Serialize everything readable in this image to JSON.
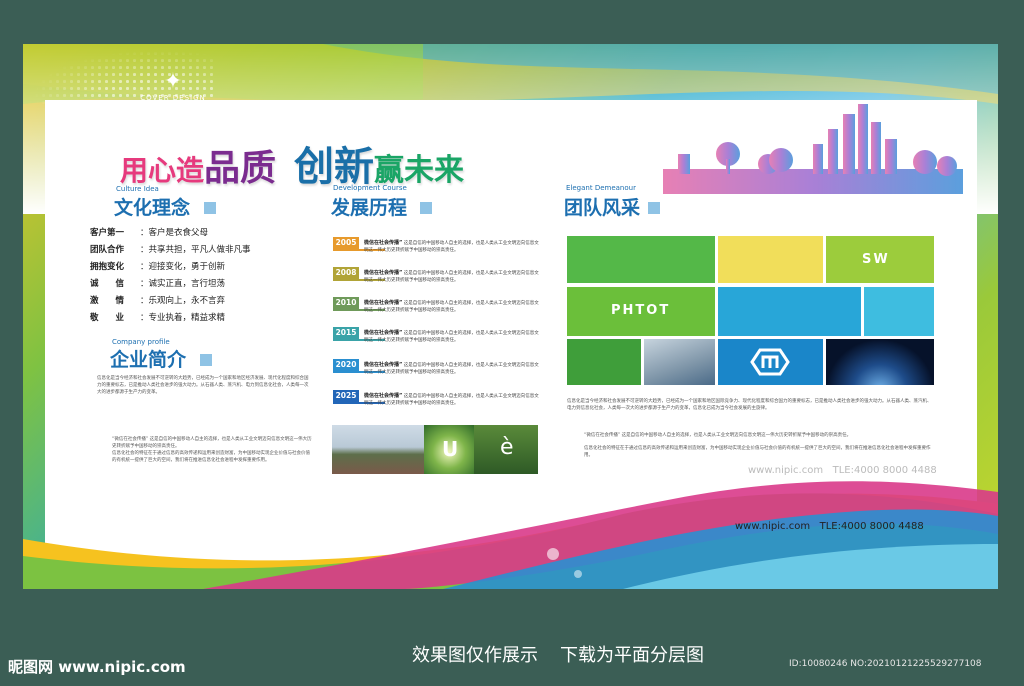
{
  "logo": {
    "mark": "✦",
    "name": "COVER DESIGN",
    "sub": "UNIQUE RECOGNIZE"
  },
  "slogan": {
    "p1": "用心造",
    "p2": "品质",
    "p3": "创新",
    "p4": "赢未来"
  },
  "culture": {
    "en": "Culture Idea",
    "title": "文化理念",
    "rows": [
      {
        "k": "客户第一",
        "v": "：客户是衣食父母"
      },
      {
        "k": "团队合作",
        "v": "：共享共担，平凡人做非凡事"
      },
      {
        "k": "拥抱变化",
        "v": "：迎接变化，勇于创新"
      },
      {
        "k": "诚　　信",
        "v": "：诚实正直，言行坦荡"
      },
      {
        "k": "激　　情",
        "v": "：乐观向上，永不言弃"
      },
      {
        "k": "敬　　业",
        "v": "：专业执着，精益求精"
      }
    ]
  },
  "profile": {
    "en": "Company profile",
    "title": "企业简介",
    "p1": "信息化是当今经济和社会发展不可逆转的大趋势，已经成为一个国家和地区经济发展、现代化程度和综合国力的重要标志，已是推动人类社会进步的强大动力。从石器人类、蒸汽机、电力到信息化社会，人类每一次大的进步都源于生产力的变革。",
    "p2": "“微信在社会传播” 这是自信的中国移动人自主的选择，也是人类从工业文明迈向信息文明这一伟大历史转折赋予中国移动的崇高责任。",
    "p3": "信息化社会的特征在于通过信息的高效传递和运用来创造财富，为中国移动实现企业价值与社会价值的有机统一提供了巨大的空间，我们将在推进信息化社会进程中发挥重要作用。"
  },
  "development": {
    "en": "Development Course",
    "title": "发展历程",
    "items": [
      {
        "year": "2005",
        "head": "微信在社会传播”",
        "body": "这是自信的中国移动人自主的选择，也是人类从工业文明迈向信息文明这一伟大历史转折赋予中国移动的崇高责任。"
      },
      {
        "year": "2008",
        "head": "微信在社会传播”",
        "body": "这是自信的中国移动人自主的选择，也是人类从工业文明迈向信息文明这一伟大历史转折赋予中国移动的崇高责任。"
      },
      {
        "year": "2010",
        "head": "微信在社会传播”",
        "body": "这是自信的中国移动人自主的选择，也是人类从工业文明迈向信息文明这一伟大历史转折赋予中国移动的崇高责任。"
      },
      {
        "year": "2015",
        "head": "微信在社会传播”",
        "body": "这是自信的中国移动人自主的选择，也是人类从工业文明迈向信息文明这一伟大历史转折赋予中国移动的崇高责任。"
      },
      {
        "year": "2020",
        "head": "微信在社会传播”",
        "body": "这是自信的中国移动人自主的选择，也是人类从工业文明迈向信息文明这一伟大历史转折赋予中国移动的崇高责任。"
      },
      {
        "year": "2025",
        "head": "微信在社会传播”",
        "body": "这是自信的中国移动人自主的选择，也是人类从工业文明迈向信息文明这一伟大历史转折赋予中国移动的崇高责任。"
      }
    ],
    "photo_letters": [
      "U",
      "è"
    ]
  },
  "team": {
    "en": "Elegant Demeanour",
    "title": "团队风采",
    "tile_sw": "SW",
    "tile_phtot": "PHTOT",
    "p1": "信息化是当今经济和社会发展不可逆转的大趋势，已经成为一个国家和地区国际竞争力、现代化程度和综合国力的重要标志，已是推动人类社会进步的强大动力。从石器人类、蒸汽机、电力到信息化社会，人类每一次大的进步都源于生产力的变革，信息化已成为当今社会发展的主旋律。",
    "p2": "“微信在社会传播” 这是自信的中国移动人自主的选择，也是人类从工业文明迈向信息文明这一伟大历史转折赋予中国移动的崇高责任。",
    "p3": "信息化社会的特征在于通过信息的高效传递和运用来创造财富，为中国移动实现企业价值与社会价值的有机统一提供了巨大的空间，我们将在推进信息化社会进程中发挥重要作用。"
  },
  "contact": {
    "url": "www.nipic.com",
    "tel": "TLE:4000 8000 4488"
  },
  "caption": {
    "left": "效果图仅作展示",
    "right": "下载为平面分层图"
  },
  "watermark": {
    "site": "昵图网 www.nipic.com",
    "id": "ID:10080246 NO:20210121225529277108"
  }
}
